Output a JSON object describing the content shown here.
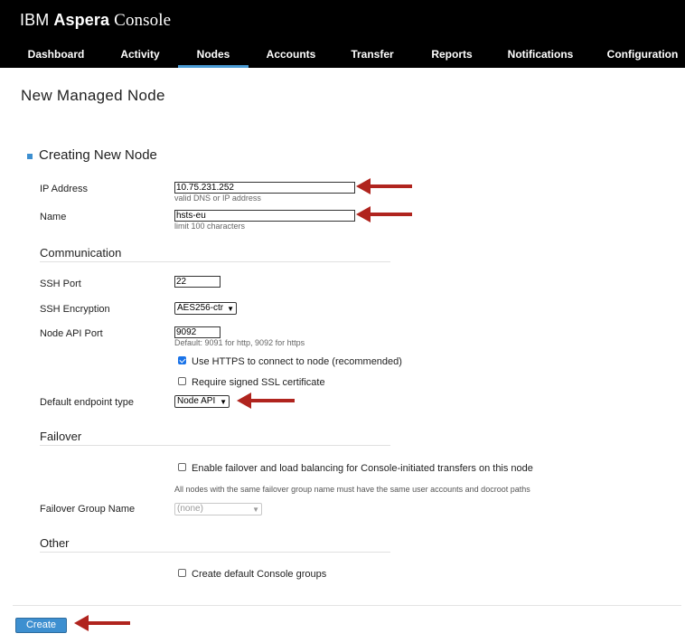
{
  "header": {
    "brand_ibm": "IBM",
    "brand_aspera": "Aspera",
    "brand_console": "Console",
    "nav": [
      {
        "label": "Dashboard",
        "active": false
      },
      {
        "label": "Activity",
        "active": false
      },
      {
        "label": "Nodes",
        "active": true
      },
      {
        "label": "Accounts",
        "active": false
      },
      {
        "label": "Transfer",
        "active": false
      },
      {
        "label": "Reports",
        "active": false
      },
      {
        "label": "Notifications",
        "active": false
      },
      {
        "label": "Configuration",
        "active": false
      }
    ],
    "accent_color": "#4a9bd4"
  },
  "page": {
    "title": "New Managed Node",
    "section_title": "Creating New Node"
  },
  "form": {
    "ip_address": {
      "label": "IP Address",
      "value": "10.75.231.252",
      "hint": "valid DNS or IP address"
    },
    "name": {
      "label": "Name",
      "value": "hsts-eu",
      "hint": "limit 100 characters"
    },
    "communication_heading": "Communication",
    "ssh_port": {
      "label": "SSH Port",
      "value": "22"
    },
    "ssh_encryption": {
      "label": "SSH Encryption",
      "value": "AES256-ctr"
    },
    "node_api_port": {
      "label": "Node API Port",
      "value": "9092",
      "hint": "Default: 9091 for http, 9092 for https"
    },
    "use_https": {
      "label": "Use HTTPS to connect to node (recommended)",
      "checked": true
    },
    "require_ssl": {
      "label": "Require signed SSL certificate",
      "checked": false
    },
    "endpoint_type": {
      "label": "Default endpoint type",
      "value": "Node API"
    },
    "failover_heading": "Failover",
    "enable_failover": {
      "label": "Enable failover and load balancing for Console-initiated transfers on this node",
      "checked": false
    },
    "failover_note": "All nodes with the same failover group name must have the same user accounts and docroot paths",
    "failover_group": {
      "label": "Failover Group Name",
      "value": "(none)",
      "disabled": true
    },
    "other_heading": "Other",
    "create_groups": {
      "label": "Create default Console groups",
      "checked": false
    }
  },
  "actions": {
    "create_label": "Create",
    "button_color": "#3d8fd0"
  },
  "annotation": {
    "arrow_color": "#b0241e"
  }
}
